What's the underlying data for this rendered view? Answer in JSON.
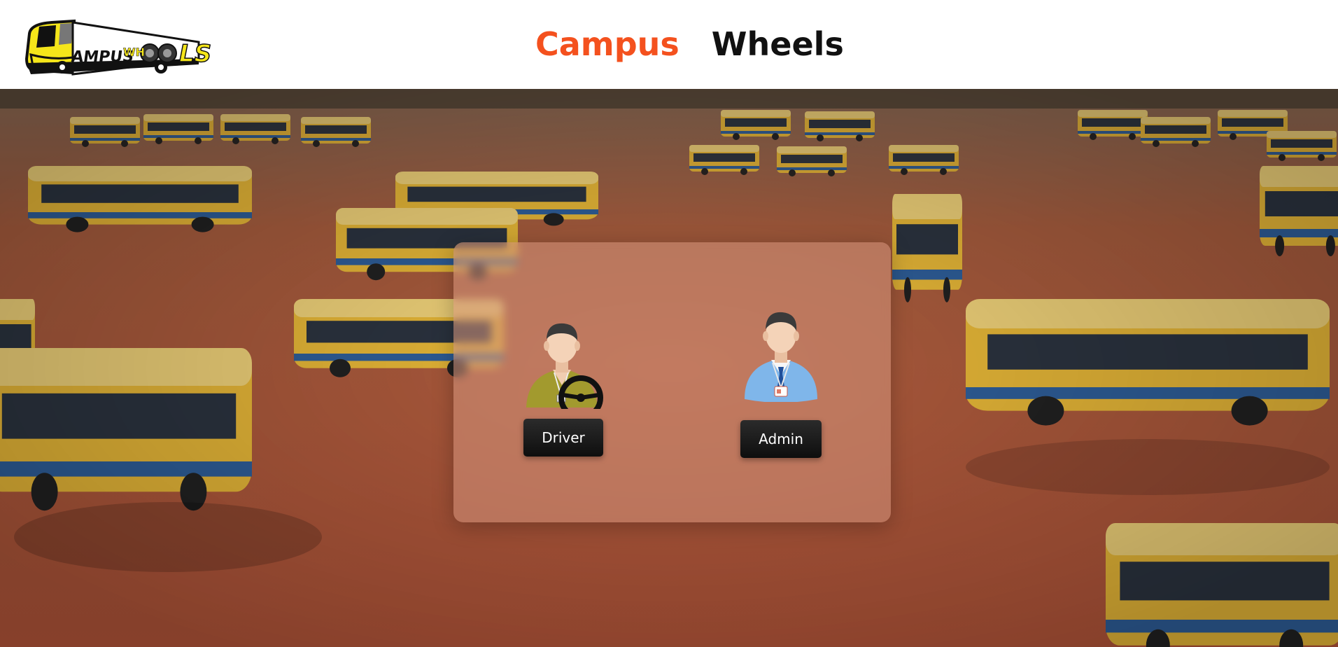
{
  "header": {
    "logo_text": "CAMPUS WHEELS",
    "title_part1": "Campus",
    "title_part2": "Wheels"
  },
  "colors": {
    "accent": "#f4511e",
    "title_dark": "#111111",
    "button_bg": "#1a1a1a",
    "card_tint": "#d6967d"
  },
  "roles": [
    {
      "label": "Driver",
      "icon": "driver-with-steering-wheel-icon"
    },
    {
      "label": "Admin",
      "icon": "admin-with-id-badge-icon"
    }
  ],
  "background": {
    "icon": "parked-school-buses-photo"
  }
}
